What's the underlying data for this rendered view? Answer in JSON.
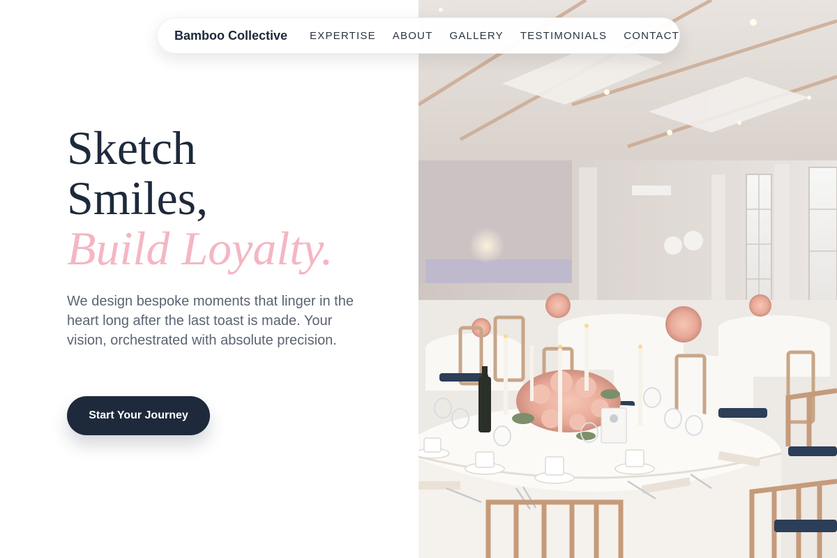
{
  "nav": {
    "brand": "Bamboo Collective",
    "links": [
      "EXPERTISE",
      "ABOUT",
      "GALLERY",
      "TESTIMONIALS",
      "CONTACT"
    ]
  },
  "hero": {
    "headline_line1": "Sketch",
    "headline_line2": "Smiles,",
    "headline_accent": "Build Loyalty.",
    "subtext": "We design bespoke moments that linger in the heart long after the last toast is made. Your vision, orchestrated with absolute precision.",
    "cta_label": "Start Your Journey",
    "photo_alt": "Elegant banquet hall with round tables, white linens, floral centerpieces and chiavari chairs"
  },
  "colors": {
    "primary": "#1e293b",
    "accent": "#f4b6c2",
    "body_text": "#5b6472",
    "background": "#ffffff"
  }
}
